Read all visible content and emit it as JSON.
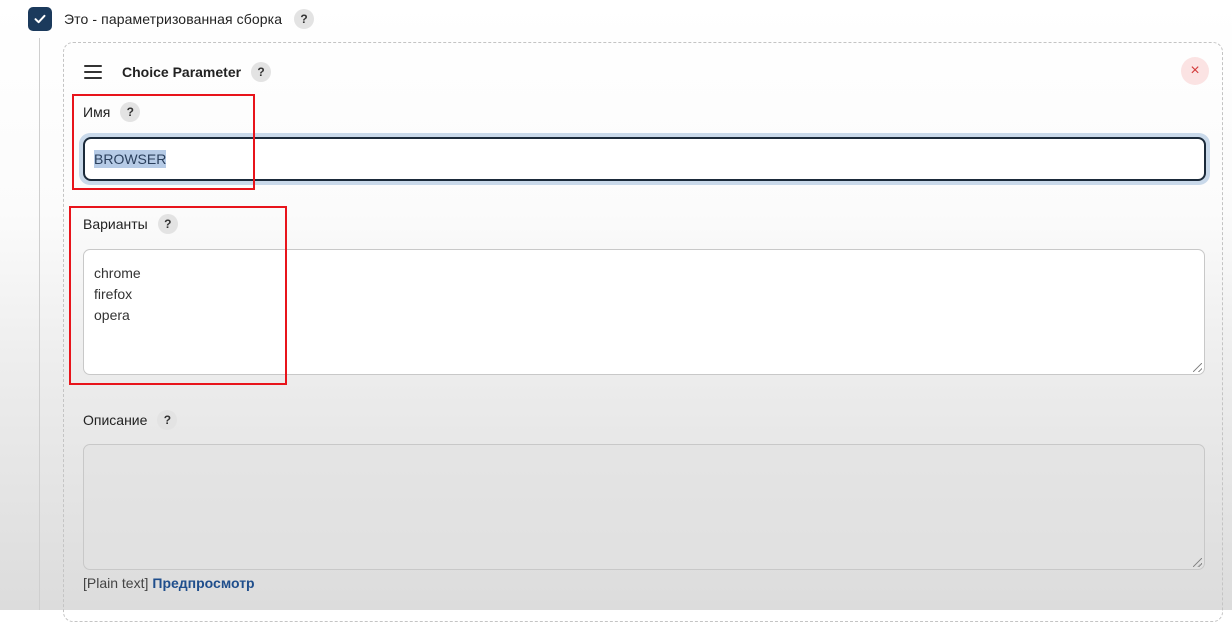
{
  "build_option": {
    "label": "Это - параметризованная сборка",
    "help": "?",
    "checked": true
  },
  "parameter": {
    "title": "Choice Parameter",
    "help": "?",
    "close": "×"
  },
  "fields": {
    "name": {
      "label": "Имя",
      "help": "?",
      "value": "BROWSER"
    },
    "choices": {
      "label": "Варианты",
      "help": "?",
      "lines": [
        "chrome",
        "firefox",
        "opera"
      ]
    },
    "description": {
      "label": "Описание",
      "help": "?",
      "value": ""
    }
  },
  "footer": {
    "plain_text": "[Plain text]",
    "preview_link": "Предпросмотр"
  },
  "colors": {
    "checkbox": "#1b3a5c",
    "highlight": "#e8141b",
    "link": "#1f4e8c"
  }
}
